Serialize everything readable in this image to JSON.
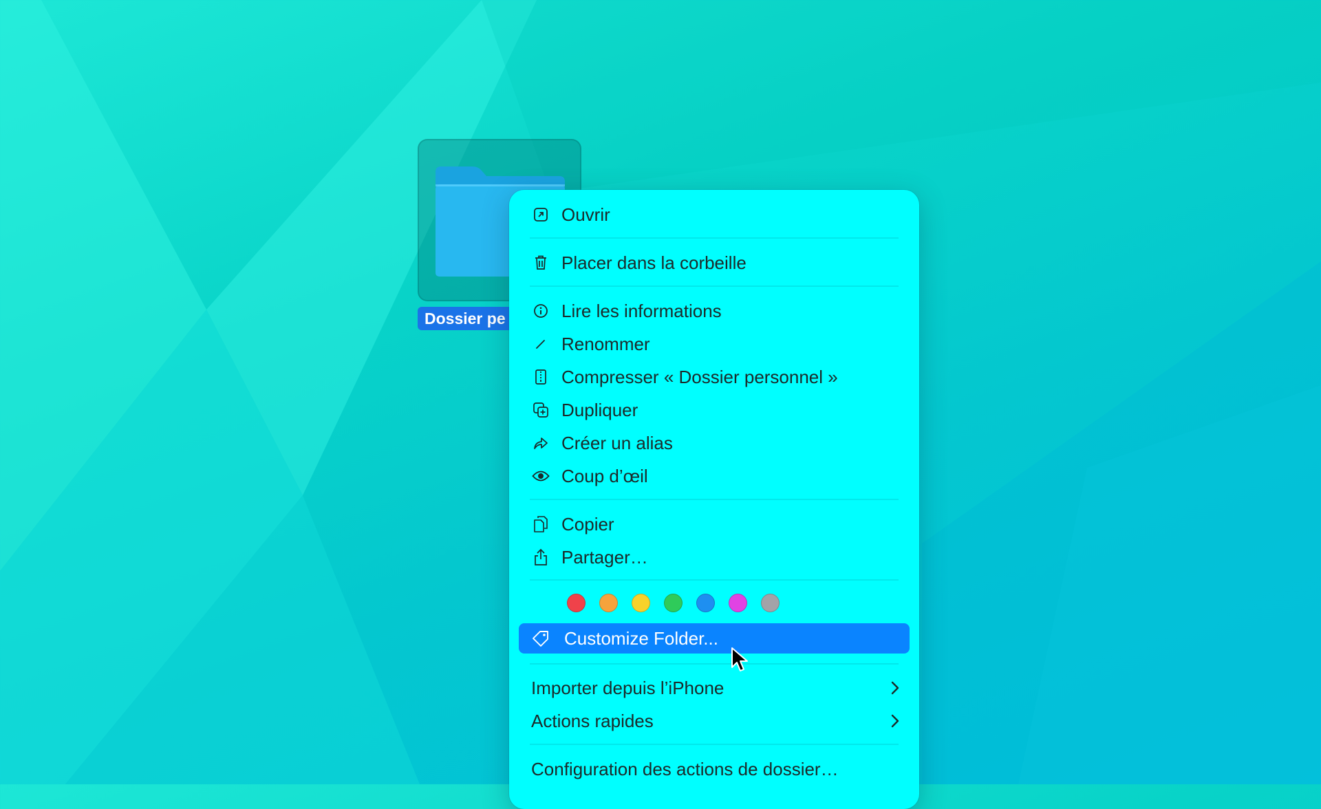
{
  "desktop": {
    "folder_label": "Dossier pe"
  },
  "menu": {
    "sections": [
      {
        "items": [
          {
            "id": "open",
            "icon": "open-icon",
            "label": "Ouvrir"
          }
        ]
      },
      {
        "items": [
          {
            "id": "trash",
            "icon": "trash-icon",
            "label": "Placer dans la corbeille"
          }
        ]
      },
      {
        "items": [
          {
            "id": "get-info",
            "icon": "info-icon",
            "label": "Lire les informations"
          },
          {
            "id": "rename",
            "icon": "pencil-icon",
            "label": "Renommer"
          },
          {
            "id": "compress",
            "icon": "zip-icon",
            "label": "Compresser « Dossier personnel »"
          },
          {
            "id": "duplicate",
            "icon": "duplicate-icon",
            "label": "Dupliquer"
          },
          {
            "id": "alias",
            "icon": "alias-arrow-icon",
            "label": "Créer un alias"
          },
          {
            "id": "quicklook",
            "icon": "eye-icon",
            "label": "Coup d’œil"
          }
        ]
      },
      {
        "items": [
          {
            "id": "copy",
            "icon": "copy-icon",
            "label": "Copier"
          },
          {
            "id": "share",
            "icon": "share-icon",
            "label": "Partager…"
          }
        ]
      },
      {
        "items": [
          {
            "id": "customize",
            "icon": "tag-icon",
            "label": "Customize Folder...",
            "highlighted": true
          }
        ]
      },
      {
        "items": [
          {
            "id": "import-iphone",
            "label": "Importer depuis l’iPhone",
            "submenu": true
          },
          {
            "id": "quick-actions",
            "label": "Actions rapides",
            "submenu": true
          }
        ]
      },
      {
        "items": [
          {
            "id": "folder-actions",
            "label": "Configuration des actions de dossier…"
          }
        ]
      }
    ],
    "tag_colors": [
      {
        "name": "red",
        "color": "#f0424a"
      },
      {
        "name": "orange",
        "color": "#f6a33c"
      },
      {
        "name": "yellow",
        "color": "#f8d22a"
      },
      {
        "name": "green",
        "color": "#2fcb5a"
      },
      {
        "name": "blue",
        "color": "#1e8ff0"
      },
      {
        "name": "purple",
        "color": "#e043e3"
      },
      {
        "name": "gray",
        "color": "#a3a3a8"
      }
    ],
    "highlight_color": "#0a84ff"
  }
}
